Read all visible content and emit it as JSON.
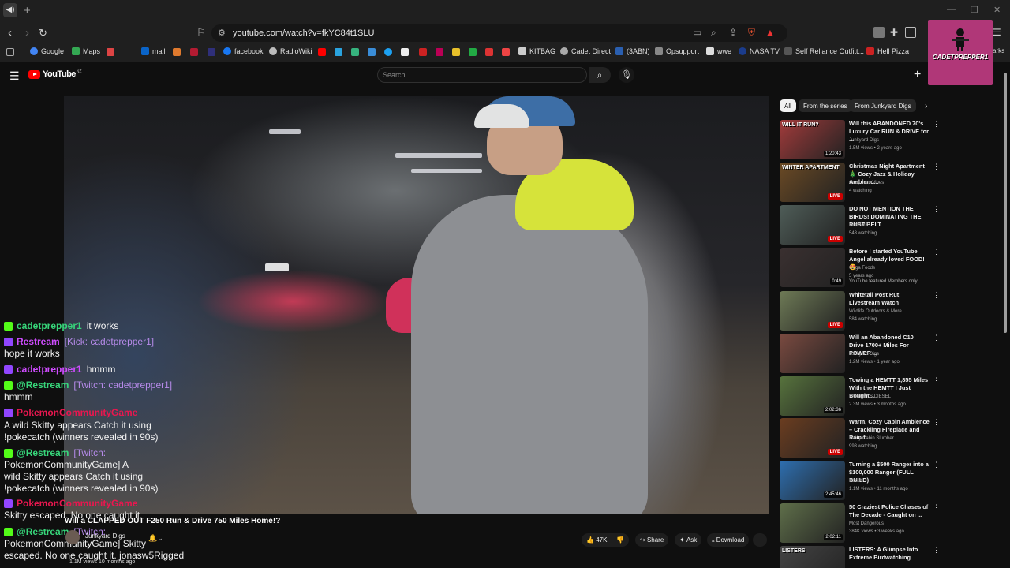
{
  "browser": {
    "url": "youtube.com/watch?v=fkYC84t1SLU",
    "bookmarks": [
      "Google",
      "Maps",
      "mail",
      "facebook",
      "RadioWiki",
      "KITBAG",
      "Cadet Direct",
      "(3ABN)",
      "Opsupport",
      "wwe",
      "NASA TV",
      "Self Reliance Outfitt...",
      "Hell Pizza"
    ],
    "bookmarks_overflow": "arks"
  },
  "youtube": {
    "logo": "YouTube",
    "region": "NZ",
    "search_placeholder": "Search"
  },
  "channel_badge": {
    "text": "CADETPREPPER1"
  },
  "chat": [
    {
      "platform": "kick",
      "name": "cadetprepper1",
      "message": "it works",
      "name_color": "#37d67a"
    },
    {
      "platform": "twitch",
      "name": "Restream",
      "message": "[Kick: cadetprepper1]",
      "name_color": "#cf4cff"
    },
    {
      "text": "hope it works"
    },
    {
      "platform": "twitch",
      "name": "cadetprepper1",
      "message": "hmmm",
      "name_color": "#cf4cff"
    },
    {
      "platform": "kick",
      "name": "@Restream",
      "message": "[Twitch: cadetprepper1]",
      "name_color": "#37d67a"
    },
    {
      "text": "hmmm"
    },
    {
      "platform": "twitch",
      "name": "PokemonCommunityGame",
      "message": "",
      "name_color": "#e8174f"
    },
    {
      "text": "A wild Skitty appears Catch it using"
    },
    {
      "text": "!pokecatch (winners revealed in 90s)"
    },
    {
      "platform": "kick",
      "name": "@Restream",
      "message": "[Twitch:",
      "name_color": "#37d67a"
    },
    {
      "text": "PokemonCommunityGame] A"
    },
    {
      "text": "wild Skitty appears Catch it using"
    },
    {
      "text": "!pokecatch (winners revealed in 90s)"
    },
    {
      "platform": "twitch",
      "name": "PokemonCommunityGame",
      "message": "",
      "name_color": "#e8174f"
    },
    {
      "text": "Skitty escaped. No one caught it."
    },
    {
      "platform": "kick",
      "name": "@Restream",
      "message": "[Twitch:",
      "name_color": "#37d67a"
    },
    {
      "text": "PokemonCommunityGame] Skitty"
    },
    {
      "text": "escaped. No one caught it. jonasw5Rigged"
    }
  ],
  "video": {
    "title": "Will a CLAPPED OUT F250 Run & Drive 750 Miles Home!?",
    "channel": "Junkyard Digs",
    "likes": "47K",
    "share": "Share",
    "ask": "Ask",
    "download": "Download",
    "views": "1.1M views  10 months ago"
  },
  "chips": [
    "All",
    "From the series",
    "From Junkyard Digs"
  ],
  "recommendations": [
    {
      "title": "Will this ABANDONED 70's Luxury Car RUN & DRIVE for ...",
      "channel": "Junkyard Digs",
      "meta": "1.5M views • 2 years ago",
      "duration": "1:20:43",
      "live": "",
      "thumb": "#a23b3b"
    },
    {
      "title": "Christmas Night Apartment 🎄 Cozy Jazz & Holiday Ambienc...",
      "channel": "Cozy Jazz Vibes",
      "meta": "4 watching",
      "duration": "",
      "live": "LIVE",
      "thumb": "#6b4a24"
    },
    {
      "title": "DO NOT MENTION THE BIRDS! DOMINATING THE RUST BELT",
      "channel": "HutchMF",
      "meta": "543 watching",
      "duration": "",
      "live": "LIVE",
      "thumb": "#4f5d58"
    },
    {
      "title": "Before I started YouTube Angel already loved FOOD! 😍",
      "channel": "Guga Foods",
      "meta": "5 years ago",
      "extra": "YouTube featured  Members only",
      "duration": "0:49",
      "live": "",
      "thumb": "#3a3030"
    },
    {
      "title": "Whitetail Post Rut Livestream Watch",
      "channel": "Wildlife Outdoors & More",
      "meta": "584 watching",
      "duration": "",
      "live": "LIVE",
      "thumb": "#6e7a56"
    },
    {
      "title": "Will an Abandoned C10 Drive 1700+ Miles For POWER ...",
      "channel": "Junkyard Digs",
      "meta": "1.2M views • 1 year ago",
      "duration": "",
      "live": "",
      "thumb": "#7a4a40"
    },
    {
      "title": "Towing a HEMTT 1,855 Miles With the HEMTT I Just Bought...",
      "channel": "MURPHYS DIESEL",
      "meta": "2.3M views • 3 months ago",
      "duration": "2:02:36",
      "live": "",
      "thumb": "#57733d"
    },
    {
      "title": "Warm, Cozy Cabin Ambience – Crackling Fireplace and Rain f...",
      "channel": "Rainy Cabin Slumber",
      "meta": "993 watching",
      "duration": "",
      "live": "LIVE",
      "thumb": "#6b3d20"
    },
    {
      "title": "Turning a $500 Ranger into a $100,000 Ranger (FULL BUILD)",
      "channel": "Donut",
      "meta": "1.1M views • 11 months ago",
      "duration": "2:45:46",
      "live": "",
      "thumb": "#2e6fb0"
    },
    {
      "title": "50 Craziest Police Chases of The Decade - Caught on ...",
      "channel": "Most Dangerous",
      "meta": "384K views • 3 weeks ago",
      "duration": "2:02:11",
      "live": "",
      "thumb": "#5f6f4a"
    },
    {
      "title": "LISTERS: A Glimpse Into Extreme Birdwatching",
      "channel": "",
      "meta": "",
      "duration": "",
      "live": "",
      "thumb": "#444444"
    }
  ],
  "thumb_overlays": [
    "WILL IT RUN?",
    "WINTER APARTMENT",
    "LISTERS"
  ]
}
